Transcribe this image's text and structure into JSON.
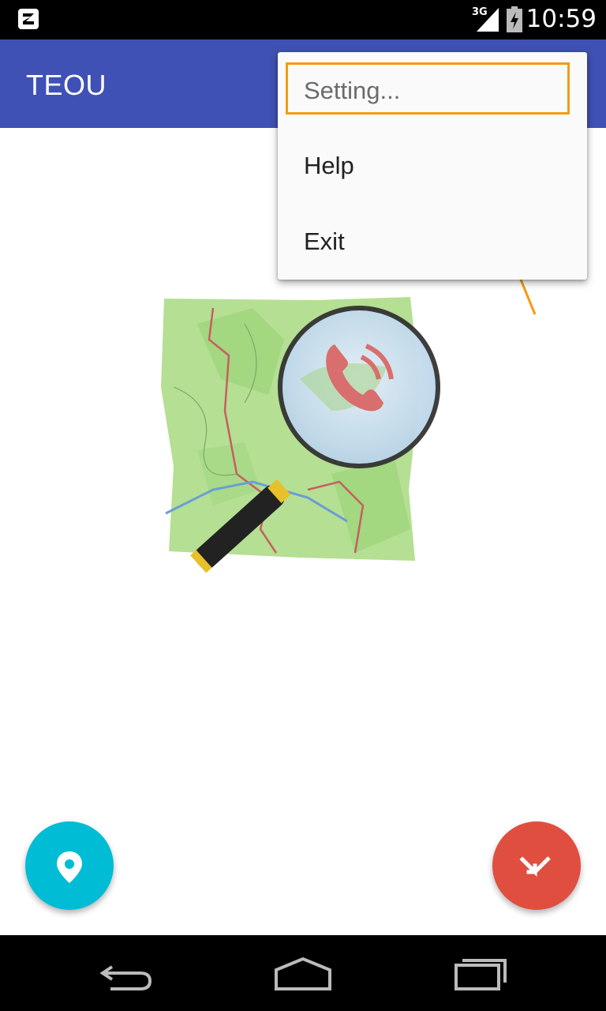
{
  "status_bar": {
    "network_type": "3G",
    "time": "10:59",
    "icons": [
      "app-notification-icon",
      "signal-icon",
      "battery-charging-icon"
    ]
  },
  "app_bar": {
    "title": "TEOU"
  },
  "menu": {
    "items": [
      {
        "label": "Setting..."
      },
      {
        "label": "Help"
      },
      {
        "label": "Exit"
      }
    ]
  },
  "hero": {
    "icon": "map-magnifier-phone-logo"
  },
  "fabs": {
    "left_icon": "location-pin-icon",
    "right_icon": "call-received-icon"
  },
  "nav_bar": {
    "icons": [
      "back-icon",
      "home-icon",
      "recents-icon"
    ]
  },
  "colors": {
    "primary": "#3f51b5",
    "fab_left": "#00bcd4",
    "fab_right": "#e04e3f",
    "highlight": "#f39c12"
  }
}
